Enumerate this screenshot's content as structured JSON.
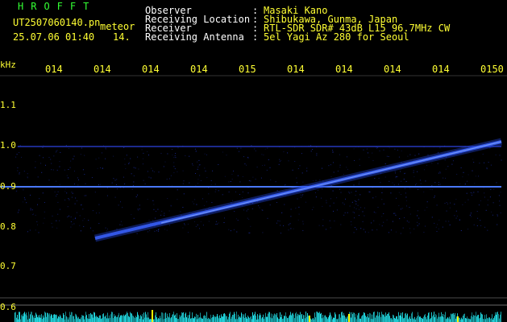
{
  "colors": {
    "background": "#000000",
    "header_label": "#ffffff",
    "header_value": "#ffff33",
    "brand": "#33ff33",
    "axis_text": "#ffff33",
    "echo": "#3a5cff",
    "carrier": "#3d6bff",
    "noise": "#1d2fa8",
    "bottom_noise": "#22e0e8",
    "tick_mark": "#ffff00"
  },
  "header": {
    "brand": "HROFFT",
    "filename": "UT2507060140.pn",
    "file_tag": "meteor",
    "datetime": "25.07.06 01:40",
    "count": "14.",
    "labels": {
      "observer": "Observer",
      "location": "Receiving Location",
      "receiver": "Receiver",
      "antenna": "Receiving Antenna"
    },
    "separator": ":",
    "values": {
      "observer": "Masaki Kano",
      "location": "Shibukawa, Gunma, Japan",
      "receiver": "RTL-SDR SDR# 43dB L15 96.7MHz CW",
      "antenna": "5el Yagi Az 280 for Seoul"
    }
  },
  "spectrogram": {
    "freq_unit": "kHz",
    "freq_ticks": [
      "1.1",
      "1.0",
      "0.9",
      "0.8",
      "0.7",
      "0.6"
    ],
    "time_ticks": [
      "014",
      "014",
      "014",
      "014",
      "015",
      "014",
      "014",
      "014",
      "014",
      "0150"
    ]
  }
}
